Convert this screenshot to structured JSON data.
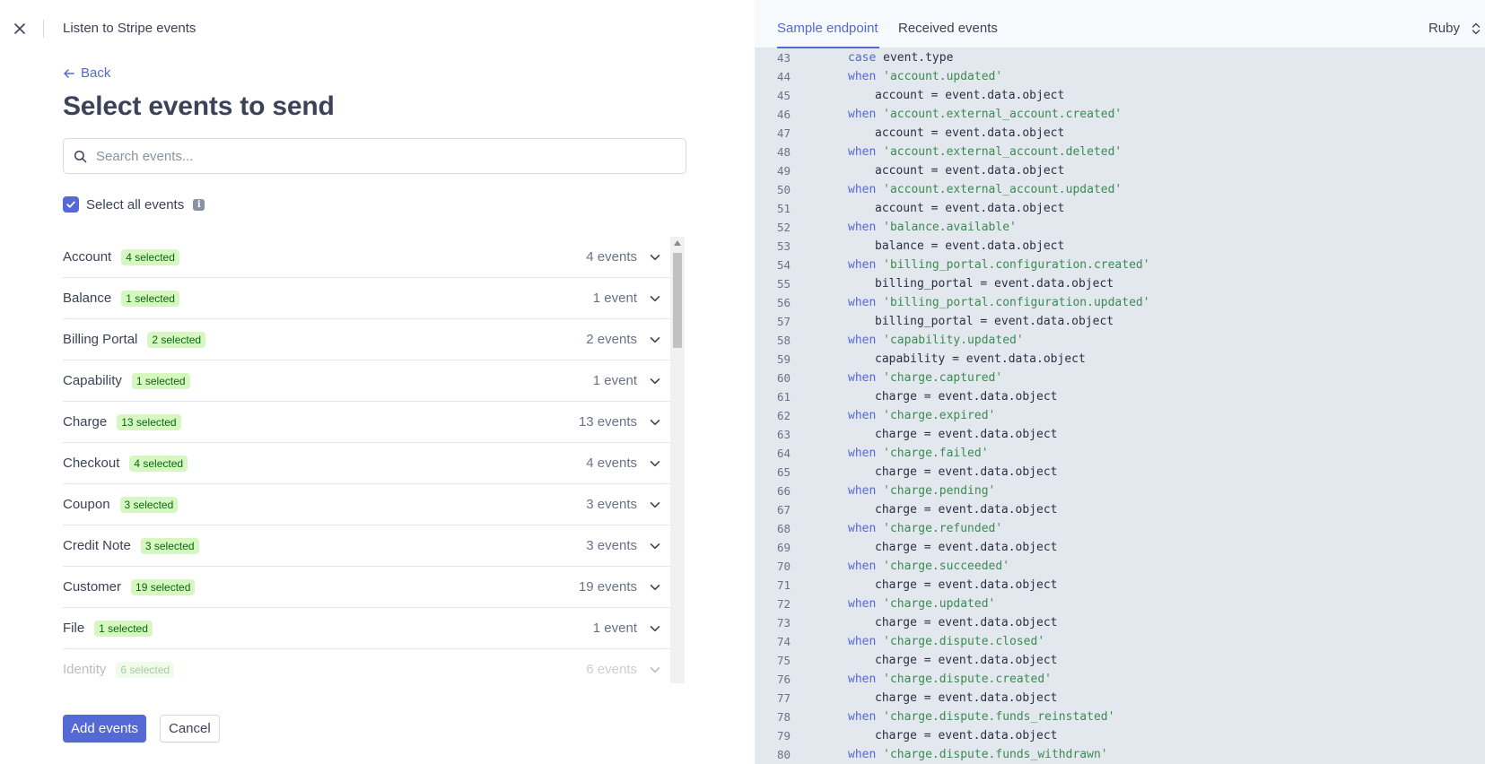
{
  "header": {
    "title": "Listen to Stripe events"
  },
  "back_label": "Back",
  "page_title": "Select events to send",
  "search": {
    "placeholder": "Search events..."
  },
  "select_all": {
    "label": "Select all events",
    "checked": true
  },
  "event_groups": [
    {
      "name": "Account",
      "badge": "4 selected",
      "count": "4 events"
    },
    {
      "name": "Balance",
      "badge": "1 selected",
      "count": "1 event"
    },
    {
      "name": "Billing Portal",
      "badge": "2 selected",
      "count": "2 events"
    },
    {
      "name": "Capability",
      "badge": "1 selected",
      "count": "1 event"
    },
    {
      "name": "Charge",
      "badge": "13 selected",
      "count": "13 events"
    },
    {
      "name": "Checkout",
      "badge": "4 selected",
      "count": "4 events"
    },
    {
      "name": "Coupon",
      "badge": "3 selected",
      "count": "3 events"
    },
    {
      "name": "Credit Note",
      "badge": "3 selected",
      "count": "3 events"
    },
    {
      "name": "Customer",
      "badge": "19 selected",
      "count": "19 events"
    },
    {
      "name": "File",
      "badge": "1 selected",
      "count": "1 event"
    },
    {
      "name": "Identity",
      "badge": "6 selected",
      "count": "6 events"
    }
  ],
  "buttons": {
    "add": "Add events",
    "cancel": "Cancel"
  },
  "code_panel": {
    "tabs": [
      "Sample endpoint",
      "Received events"
    ],
    "active_tab": "Sample endpoint",
    "language": "Ruby",
    "lines": [
      {
        "n": "43",
        "indent": 1,
        "kw": "case",
        "str": "",
        "rest": " event.type"
      },
      {
        "n": "44",
        "indent": 1,
        "kw": "when",
        "str": " 'account.updated'",
        "rest": ""
      },
      {
        "n": "45",
        "indent": 2,
        "kw": "",
        "str": "",
        "rest": "account = event.data.object"
      },
      {
        "n": "46",
        "indent": 1,
        "kw": "when",
        "str": " 'account.external_account.created'",
        "rest": ""
      },
      {
        "n": "47",
        "indent": 2,
        "kw": "",
        "str": "",
        "rest": "account = event.data.object"
      },
      {
        "n": "48",
        "indent": 1,
        "kw": "when",
        "str": " 'account.external_account.deleted'",
        "rest": ""
      },
      {
        "n": "49",
        "indent": 2,
        "kw": "",
        "str": "",
        "rest": "account = event.data.object"
      },
      {
        "n": "50",
        "indent": 1,
        "kw": "when",
        "str": " 'account.external_account.updated'",
        "rest": ""
      },
      {
        "n": "51",
        "indent": 2,
        "kw": "",
        "str": "",
        "rest": "account = event.data.object"
      },
      {
        "n": "52",
        "indent": 1,
        "kw": "when",
        "str": " 'balance.available'",
        "rest": ""
      },
      {
        "n": "53",
        "indent": 2,
        "kw": "",
        "str": "",
        "rest": "balance = event.data.object"
      },
      {
        "n": "54",
        "indent": 1,
        "kw": "when",
        "str": " 'billing_portal.configuration.created'",
        "rest": ""
      },
      {
        "n": "55",
        "indent": 2,
        "kw": "",
        "str": "",
        "rest": "billing_portal = event.data.object"
      },
      {
        "n": "56",
        "indent": 1,
        "kw": "when",
        "str": " 'billing_portal.configuration.updated'",
        "rest": ""
      },
      {
        "n": "57",
        "indent": 2,
        "kw": "",
        "str": "",
        "rest": "billing_portal = event.data.object"
      },
      {
        "n": "58",
        "indent": 1,
        "kw": "when",
        "str": " 'capability.updated'",
        "rest": ""
      },
      {
        "n": "59",
        "indent": 2,
        "kw": "",
        "str": "",
        "rest": "capability = event.data.object"
      },
      {
        "n": "60",
        "indent": 1,
        "kw": "when",
        "str": " 'charge.captured'",
        "rest": ""
      },
      {
        "n": "61",
        "indent": 2,
        "kw": "",
        "str": "",
        "rest": "charge = event.data.object"
      },
      {
        "n": "62",
        "indent": 1,
        "kw": "when",
        "str": " 'charge.expired'",
        "rest": ""
      },
      {
        "n": "63",
        "indent": 2,
        "kw": "",
        "str": "",
        "rest": "charge = event.data.object"
      },
      {
        "n": "64",
        "indent": 1,
        "kw": "when",
        "str": " 'charge.failed'",
        "rest": ""
      },
      {
        "n": "65",
        "indent": 2,
        "kw": "",
        "str": "",
        "rest": "charge = event.data.object"
      },
      {
        "n": "66",
        "indent": 1,
        "kw": "when",
        "str": " 'charge.pending'",
        "rest": ""
      },
      {
        "n": "67",
        "indent": 2,
        "kw": "",
        "str": "",
        "rest": "charge = event.data.object"
      },
      {
        "n": "68",
        "indent": 1,
        "kw": "when",
        "str": " 'charge.refunded'",
        "rest": ""
      },
      {
        "n": "69",
        "indent": 2,
        "kw": "",
        "str": "",
        "rest": "charge = event.data.object"
      },
      {
        "n": "70",
        "indent": 1,
        "kw": "when",
        "str": " 'charge.succeeded'",
        "rest": ""
      },
      {
        "n": "71",
        "indent": 2,
        "kw": "",
        "str": "",
        "rest": "charge = event.data.object"
      },
      {
        "n": "72",
        "indent": 1,
        "kw": "when",
        "str": " 'charge.updated'",
        "rest": ""
      },
      {
        "n": "73",
        "indent": 2,
        "kw": "",
        "str": "",
        "rest": "charge = event.data.object"
      },
      {
        "n": "74",
        "indent": 1,
        "kw": "when",
        "str": " 'charge.dispute.closed'",
        "rest": ""
      },
      {
        "n": "75",
        "indent": 2,
        "kw": "",
        "str": "",
        "rest": "charge = event.data.object"
      },
      {
        "n": "76",
        "indent": 1,
        "kw": "when",
        "str": " 'charge.dispute.created'",
        "rest": ""
      },
      {
        "n": "77",
        "indent": 2,
        "kw": "",
        "str": "",
        "rest": "charge = event.data.object"
      },
      {
        "n": "78",
        "indent": 1,
        "kw": "when",
        "str": " 'charge.dispute.funds_reinstated'",
        "rest": ""
      },
      {
        "n": "79",
        "indent": 2,
        "kw": "",
        "str": "",
        "rest": "charge = event.data.object"
      },
      {
        "n": "80",
        "indent": 1,
        "kw": "when",
        "str": " 'charge.dispute.funds_withdrawn'",
        "rest": ""
      }
    ]
  },
  "colors": {
    "accent": "#5469d4",
    "badge_bg": "#d7f7c2",
    "badge_text": "#05690d",
    "code_bg": "#e3e8ee",
    "code_string": "#3c8a52"
  },
  "icons": {
    "close": "close-icon",
    "back": "arrow-left-icon",
    "search": "search-icon",
    "check": "check-icon",
    "info": "info-icon",
    "expand": "chevron-down-icon",
    "language": "up-down-chevron-icon"
  }
}
